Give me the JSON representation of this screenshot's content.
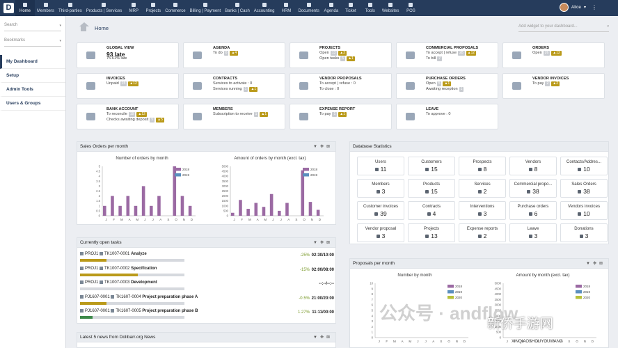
{
  "topbar": {
    "logo": "D",
    "menu": [
      "Home",
      "Members",
      "Third-parties",
      "Products | Services",
      "MRP",
      "Projects",
      "Commerce",
      "Billing | Payment",
      "Banks | Cash",
      "Accounting",
      "HRM",
      "Documents",
      "Agenda",
      "Ticket",
      "Tools",
      "Websites",
      "POS"
    ],
    "user": "Alice"
  },
  "sidebar": {
    "search_placeholder": "Search",
    "bookmarks_placeholder": "Bookmarks",
    "items": [
      "My Dashboard",
      "Setup",
      "Admin Tools",
      "Users & Groups"
    ]
  },
  "main": {
    "title": "Home",
    "add_widget": "Add widget to your dashboard..."
  },
  "boxes": [
    {
      "title": "Global view",
      "l1": "93 late",
      "l2": "75.61% late",
      "big": true
    },
    {
      "title": "Agenda",
      "l1": "To do",
      "b1": "6",
      "w1": "4"
    },
    {
      "title": "Projects",
      "l1": "Open",
      "b1": "13",
      "w1": "2",
      "l2": "Open tasks",
      "b2": "5",
      "w2": "1"
    },
    {
      "title": "Commercial proposals",
      "l1": "To accept | refuse",
      "b1": "28",
      "w1": "12",
      "l2": "To bill",
      "b2": "7"
    },
    {
      "title": "Orders",
      "l1": "Open",
      "b1": "26",
      "w1": "12"
    },
    {
      "title": "Invoices",
      "l1": "Unpaid",
      "b1": "15",
      "w1": "12"
    },
    {
      "title": "Contracts",
      "l1": "Services to activate : 0",
      "l2": "Services running",
      "b2": "1",
      "w2": "1"
    },
    {
      "title": "Vendor proposals",
      "l1": "To accept | refuse : 0",
      "l2": "To close : 0"
    },
    {
      "title": "Purchase orders",
      "l1": "Open",
      "b1": "5",
      "w1": "1",
      "l2": "Awaiting reception",
      "b2": "1"
    },
    {
      "title": "Vendor invoices",
      "l1": "To pay",
      "b1": "2",
      "w1": "2"
    },
    {
      "title": "Bank account",
      "l1": "To reconcile",
      "b1": "19",
      "w1": "12",
      "l2": "Checks awaiting deposit",
      "b2": "5",
      "w2": "5"
    },
    {
      "title": "Members",
      "l1": "Subscription to receive",
      "b1": "1",
      "w1": "1"
    },
    {
      "title": "Expense report",
      "l1": "To pay",
      "b1": "1",
      "w1": "1"
    },
    {
      "title": "Leave",
      "l1": "To approve : 0"
    }
  ],
  "sales_panel": {
    "title": "Sales Orders per month",
    "chart1_title": "Number of orders by month",
    "chart2_title": "Amount of orders by month (excl. tax)",
    "legend": [
      "2018",
      "2019"
    ]
  },
  "chart_data": [
    {
      "type": "bar",
      "title": "Number of orders by month",
      "categories": [
        "J",
        "F",
        "M",
        "A",
        "M",
        "J",
        "J",
        "A",
        "S",
        "O",
        "N",
        "D"
      ],
      "ylim": [
        0,
        5
      ],
      "yticks": [
        "0",
        "0.5",
        "1",
        "1.5",
        "2",
        "2.5",
        "3",
        "3.5",
        "4",
        "4.5",
        "5"
      ],
      "series": [
        {
          "name": "2018",
          "color": "#9b6aa3",
          "values": [
            1,
            2,
            1,
            2,
            1,
            3,
            1,
            2,
            0,
            5,
            2,
            1
          ]
        },
        {
          "name": "2019",
          "color": "#5b8fbe",
          "values": [
            0,
            0,
            0,
            0,
            0,
            0,
            0,
            0,
            0,
            0,
            0,
            0
          ]
        }
      ]
    },
    {
      "type": "bar",
      "title": "Amount of orders by month (excl. tax)",
      "categories": [
        "J",
        "F",
        "M",
        "A",
        "M",
        "J",
        "J",
        "A",
        "S",
        "O",
        "N",
        "D"
      ],
      "ylim": [
        0,
        5000
      ],
      "yticks": [
        "0",
        "500",
        "1000",
        "1500",
        "2000",
        "2500",
        "3000",
        "3500",
        "4000",
        "4500",
        "5000"
      ],
      "series": [
        {
          "name": "2018",
          "color": "#9b6aa3",
          "values": [
            300,
            1600,
            700,
            1300,
            900,
            2200,
            500,
            1300,
            0,
            4600,
            1400,
            600
          ]
        },
        {
          "name": "2019",
          "color": "#5b8fbe",
          "values": [
            0,
            0,
            0,
            0,
            0,
            0,
            0,
            0,
            0,
            0,
            0,
            0
          ]
        }
      ]
    },
    {
      "type": "bar",
      "title": "Number by month",
      "categories": [
        "J",
        "F",
        "M",
        "A",
        "M",
        "J",
        "J",
        "A",
        "S",
        "O",
        "N",
        "D"
      ],
      "ylim": [
        0,
        10
      ],
      "yticks": [
        "0",
        "1",
        "2",
        "3",
        "4",
        "5",
        "6",
        "7",
        "8",
        "9",
        "10"
      ],
      "series": [
        {
          "name": "2018",
          "color": "#9b6aa3",
          "values": [
            0,
            0,
            0,
            0,
            0,
            0,
            0,
            0,
            0,
            0,
            0,
            0
          ]
        },
        {
          "name": "2019",
          "color": "#5b8fbe",
          "values": [
            0,
            0,
            0,
            0,
            0,
            0,
            0,
            0,
            0,
            0,
            0,
            0
          ]
        },
        {
          "name": "2020",
          "color": "#b7c13b",
          "values": [
            0,
            0,
            0,
            0,
            0,
            0,
            0,
            0,
            0,
            0,
            0,
            0
          ]
        }
      ]
    },
    {
      "type": "bar",
      "title": "Amount by month (excl. tax)",
      "categories": [
        "J",
        "F",
        "M",
        "A",
        "M",
        "J",
        "J",
        "A",
        "S",
        "O",
        "N",
        "D"
      ],
      "ylim": [
        0,
        5000
      ],
      "yticks": [
        "0",
        "500",
        "1000",
        "1500",
        "2000",
        "2500",
        "3000",
        "3500",
        "4000",
        "4500",
        "5000"
      ],
      "series": [
        {
          "name": "2018",
          "color": "#9b6aa3",
          "values": [
            0,
            0,
            0,
            0,
            0,
            0,
            0,
            0,
            0,
            0,
            0,
            0
          ]
        },
        {
          "name": "2019",
          "color": "#5b8fbe",
          "values": [
            0,
            0,
            0,
            0,
            0,
            0,
            0,
            0,
            0,
            0,
            0,
            0
          ]
        },
        {
          "name": "2020",
          "color": "#b7c13b",
          "values": [
            0,
            0,
            0,
            0,
            0,
            0,
            0,
            0,
            0,
            0,
            0,
            0
          ]
        }
      ]
    }
  ],
  "db_panel": {
    "title": "Database Statistics",
    "stats": [
      {
        "label": "Users",
        "value": "11"
      },
      {
        "label": "Customers",
        "value": "15"
      },
      {
        "label": "Prospects",
        "value": "8"
      },
      {
        "label": "Vendors",
        "value": "8"
      },
      {
        "label": "Contacts/Addres...",
        "value": "10"
      },
      {
        "label": "Members",
        "value": "3"
      },
      {
        "label": "Products",
        "value": "15"
      },
      {
        "label": "Services",
        "value": "2"
      },
      {
        "label": "Commercial propo...",
        "value": "38"
      },
      {
        "label": "Sales Orders",
        "value": "38"
      },
      {
        "label": "Customer invoices",
        "value": "39"
      },
      {
        "label": "Contracts",
        "value": "4"
      },
      {
        "label": "Interventions",
        "value": "3"
      },
      {
        "label": "Purchase orders",
        "value": "6"
      },
      {
        "label": "Vendors invoices",
        "value": "10"
      },
      {
        "label": "Vendor proposal",
        "value": "3"
      },
      {
        "label": "Projects",
        "value": "13"
      },
      {
        "label": "Expense reports",
        "value": "2"
      },
      {
        "label": "Leave",
        "value": "3"
      },
      {
        "label": "Donations",
        "value": "3"
      }
    ]
  },
  "tasks_panel": {
    "title": "Currently open tasks",
    "tasks": [
      {
        "ref": "PROJ1",
        "tk": "TK1007-0001",
        "name": "Analyze",
        "pct": "-25%",
        "time": "02:30/10:00",
        "progress": 0.25,
        "color": "#ba9a1a"
      },
      {
        "ref": "PROJ1",
        "tk": "TK1007-0002",
        "name": "Specification",
        "pct": "-15%",
        "time": "02:00/08:00",
        "progress": 0.55,
        "color": "#ba9a1a"
      },
      {
        "ref": "PROJ1",
        "tk": "TK1007-0003",
        "name": "Development",
        "pct": "",
        "time": "--:--/--:--",
        "progress": 0,
        "color": "#ba9a1a"
      },
      {
        "ref": "PJ1607-0001",
        "tk": "TK1607-0004",
        "name": "Project preparation phase A",
        "pct": "-0.5%",
        "time": "21:00/20:00",
        "progress": 0.25,
        "color": "#ba9a1a"
      },
      {
        "ref": "PJ1607-0001",
        "tk": "TK1607-0005",
        "name": "Project preparation phase B",
        "pct": "1.27%",
        "time": "11:11/00:00",
        "progress": 0.12,
        "color": "#3d8a4a"
      }
    ]
  },
  "news_panel": {
    "title": "Latest 5 news from Dolibarr.org News"
  },
  "proposals_panel": {
    "title": "Proposals per month",
    "chart1_title": "Number by month",
    "chart2_title": "Amount by month (excl. tax)",
    "legend": [
      "2018",
      "2019",
      "2020"
    ]
  },
  "watermark": {
    "main": "公众号 · andflow",
    "brand": "新侨手游网",
    "brand_sub": "XINQIAOSHOUYOUWANG"
  }
}
